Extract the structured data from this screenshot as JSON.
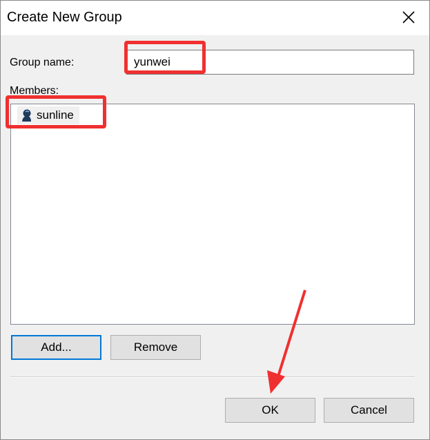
{
  "window": {
    "title": "Create New Group",
    "close_icon": "close-icon"
  },
  "form": {
    "group_name_label": "Group name:",
    "group_name_value": "yunwei",
    "members_label": "Members:"
  },
  "members": [
    {
      "name": "sunline",
      "icon": "user-icon"
    }
  ],
  "buttons": {
    "add": "Add...",
    "remove": "Remove",
    "ok": "OK",
    "cancel": "Cancel"
  },
  "colors": {
    "annotation": "#f03030",
    "focus_border": "#0078d7"
  }
}
